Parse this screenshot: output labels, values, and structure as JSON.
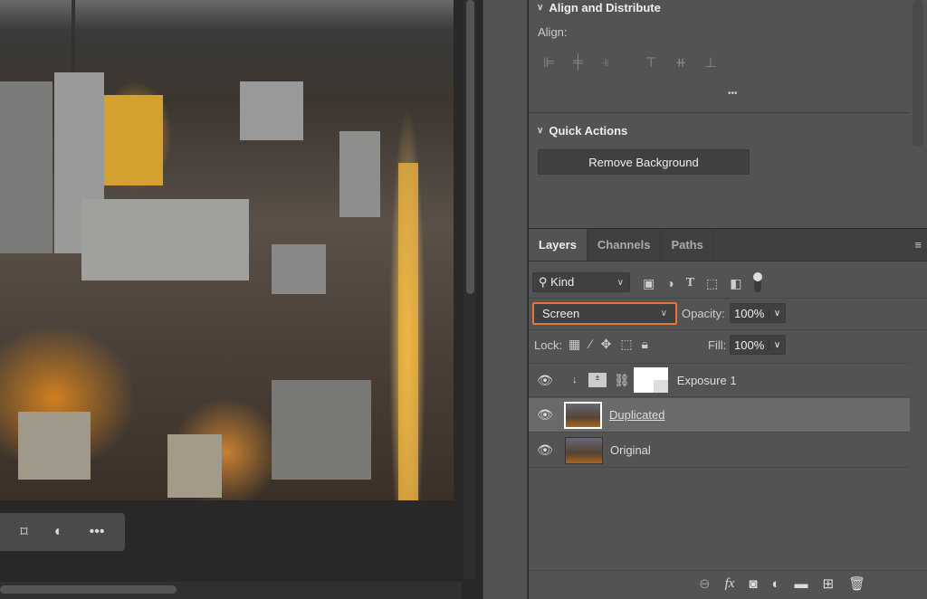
{
  "properties": {
    "align_section": "Align and Distribute",
    "align_label": "Align:",
    "more": "•••",
    "quick_actions": "Quick Actions",
    "remove_bg": "Remove Background"
  },
  "layers_panel": {
    "tabs": [
      {
        "label": "Layers",
        "active": true
      },
      {
        "label": "Channels"
      },
      {
        "label": "Paths"
      }
    ],
    "filter": "Kind",
    "blend_mode": "Screen",
    "opacity_label": "Opacity:",
    "opacity": "100%",
    "lock_label": "Lock:",
    "fill_label": "Fill:",
    "fill": "100%",
    "layers": [
      {
        "name": "Exposure 1",
        "visible": true,
        "type": "adjustment"
      },
      {
        "name": "Duplicated",
        "visible": true,
        "selected": true
      },
      {
        "name": "Original",
        "visible": true
      }
    ]
  },
  "colors": {
    "highlight": "#e8743b",
    "selected_row": "#6a6a6a"
  }
}
